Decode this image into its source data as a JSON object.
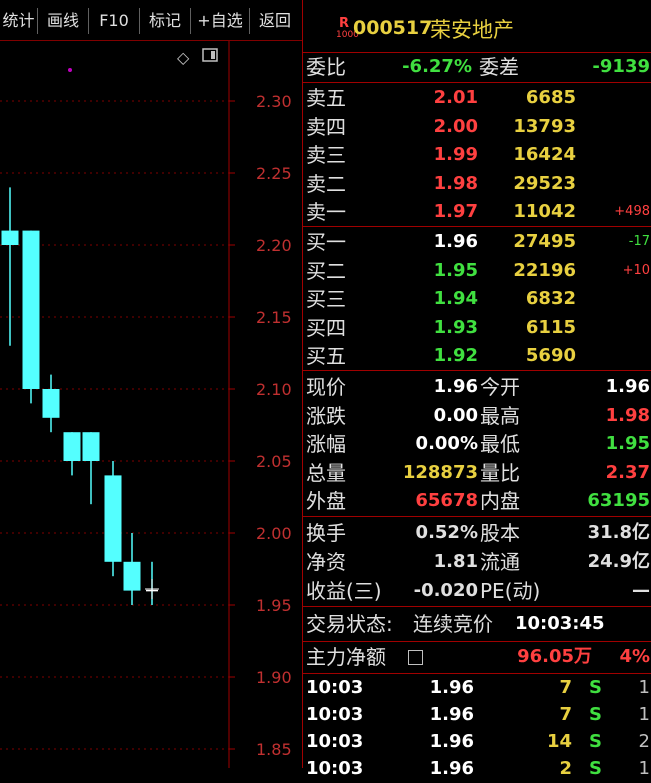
{
  "toolbar": {
    "items": [
      "统计",
      "画线",
      "F10",
      "标记",
      "+自选",
      "返回"
    ]
  },
  "stock": {
    "r_badge": "R",
    "r_sub": "1000",
    "code": "000517",
    "name": "荣安地产"
  },
  "weibi": {
    "label": "委比",
    "value": "-6.27%",
    "diff_label": "委差",
    "diff_value": "-9139"
  },
  "asks": [
    {
      "label": "卖五",
      "price": "2.01",
      "vol": "6685",
      "chg": ""
    },
    {
      "label": "卖四",
      "price": "2.00",
      "vol": "13793",
      "chg": ""
    },
    {
      "label": "卖三",
      "price": "1.99",
      "vol": "16424",
      "chg": ""
    },
    {
      "label": "卖二",
      "price": "1.98",
      "vol": "29523",
      "chg": ""
    },
    {
      "label": "卖一",
      "price": "1.97",
      "vol": "11042",
      "chg": "+498"
    }
  ],
  "bids": [
    {
      "label": "买一",
      "price": "1.96",
      "vol": "27495",
      "chg": "-17"
    },
    {
      "label": "买二",
      "price": "1.95",
      "vol": "22196",
      "chg": "+10"
    },
    {
      "label": "买三",
      "price": "1.94",
      "vol": "6832",
      "chg": ""
    },
    {
      "label": "买四",
      "price": "1.93",
      "vol": "6115",
      "chg": ""
    },
    {
      "label": "买五",
      "price": "1.92",
      "vol": "5690",
      "chg": ""
    }
  ],
  "stats": [
    {
      "l1": "现价",
      "v1": "1.96",
      "l2": "今开",
      "v2": "1.96"
    },
    {
      "l1": "涨跌",
      "v1": "0.00",
      "l2": "最高",
      "v2": "1.98"
    },
    {
      "l1": "涨幅",
      "v1": "0.00%",
      "l2": "最低",
      "v2": "1.95"
    },
    {
      "l1": "总量",
      "v1": "128873",
      "l2": "量比",
      "v2": "2.37"
    },
    {
      "l1": "外盘",
      "v1": "65678",
      "l2": "内盘",
      "v2": "63195"
    }
  ],
  "fund": [
    {
      "l1": "换手",
      "v1": "0.52%",
      "l2": "股本",
      "v2": "31.8亿"
    },
    {
      "l1": "净资",
      "v1": "1.81",
      "l2": "流通",
      "v2": "24.9亿"
    },
    {
      "l1": "收益(三)",
      "v1": "-0.020",
      "l2": "PE(动)",
      "v2": "—"
    }
  ],
  "trade_status": {
    "label": "交易状态:",
    "value": "连续竞价",
    "time": "10:03:45"
  },
  "main_force": {
    "label": "主力净额",
    "value": "96.05万",
    "pct": "4%"
  },
  "ticks": [
    {
      "time": "10:03",
      "price": "1.96",
      "vol": "7",
      "side": "S",
      "n": "1"
    },
    {
      "time": "10:03",
      "price": "1.96",
      "vol": "7",
      "side": "S",
      "n": "1"
    },
    {
      "time": "10:03",
      "price": "1.96",
      "vol": "14",
      "side": "S",
      "n": "2"
    },
    {
      "time": "10:03",
      "price": "1.96",
      "vol": "2",
      "side": "S",
      "n": "1"
    }
  ],
  "chart_data": {
    "type": "candlestick",
    "y_ticks": [
      "2.30",
      "2.25",
      "2.20",
      "2.15",
      "2.10",
      "2.05",
      "2.00",
      "1.95",
      "1.90",
      "1.85"
    ],
    "ylim": [
      1.83,
      2.33
    ],
    "candles": [
      {
        "o": 2.2,
        "c": 2.21,
        "h": 2.24,
        "l": 2.13
      },
      {
        "o": 2.21,
        "c": 2.1,
        "h": 2.21,
        "l": 2.09
      },
      {
        "o": 2.1,
        "c": 2.08,
        "h": 2.11,
        "l": 2.07
      },
      {
        "o": 2.07,
        "c": 2.05,
        "h": 2.07,
        "l": 2.04
      },
      {
        "o": 2.07,
        "c": 2.05,
        "h": 2.07,
        "l": 2.02
      },
      {
        "o": 2.04,
        "c": 1.98,
        "h": 2.05,
        "l": 1.97
      },
      {
        "o": 1.98,
        "c": 1.96,
        "h": 2.0,
        "l": 1.95
      },
      {
        "o": 1.96,
        "c": 1.96,
        "h": 1.98,
        "l": 1.95
      }
    ]
  },
  "colors": {
    "up": "#ff4040",
    "down": "#54ffff",
    "grid": "#a00000",
    "tick": "#c03030"
  }
}
